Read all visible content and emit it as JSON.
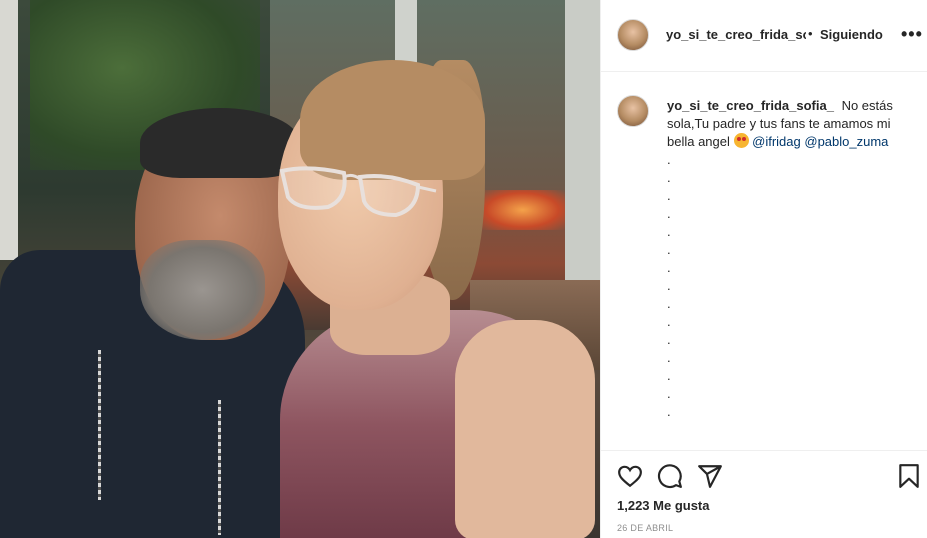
{
  "post": {
    "username": "yo_si_te_creo_frida_sofia_",
    "separator": "•",
    "follow_status": "Siguiendo",
    "more_label": "•••",
    "caption": {
      "username": "yo_si_te_creo_frida_sofia_",
      "text": "No estás sola,Tu padre y tus fans te amamos mi bella angel",
      "emoji": "smiling-face-with-heart-eyes",
      "mentions": [
        "@ifridag",
        "@pablo_zuma"
      ]
    },
    "caption_dots": [
      ".",
      ".",
      ".",
      ".",
      ".",
      ".",
      ".",
      ".",
      ".",
      ".",
      ".",
      ".",
      ".",
      ".",
      "."
    ],
    "likes": "1,223 Me gusta",
    "date": "26 DE ABRIL"
  },
  "icons": [
    "heart-icon",
    "comment-icon",
    "share-icon",
    "bookmark-icon"
  ]
}
